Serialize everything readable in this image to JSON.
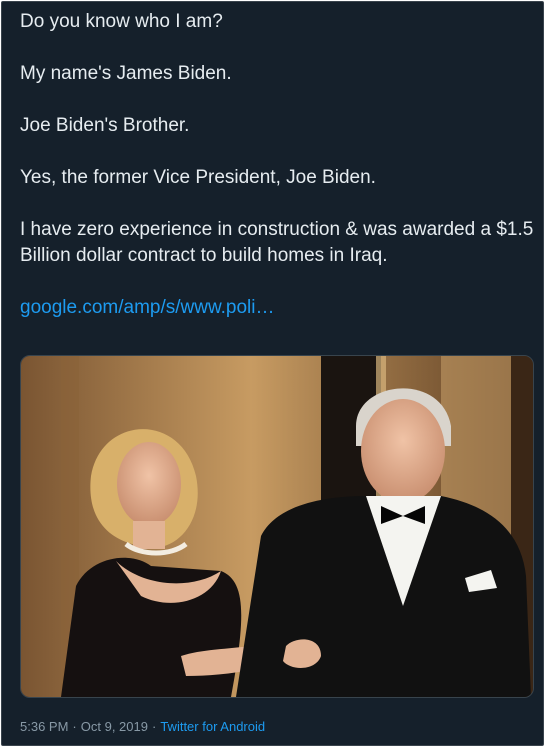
{
  "tweet": {
    "lines": [
      "Do you know who I am?",
      "My name's James Biden.",
      "Joe Biden's Brother.",
      "Yes, the former Vice President, Joe Biden.",
      "I have zero experience in construction & was awarded a $1.5 Billion dollar contract to build homes in Iraq."
    ],
    "link_text": "google.com/amp/s/www.poli…"
  },
  "media": {
    "description_icon": "photo-of-man-in-tuxedo-and-woman-in-black-dress"
  },
  "meta": {
    "time": "5:36 PM",
    "date": "Oct 9, 2019",
    "separator": "·",
    "source": "Twitter for Android"
  },
  "colors": {
    "background": "#15202b",
    "text": "#e6ecf0",
    "link": "#1d9bf0",
    "muted": "#8899a6"
  }
}
